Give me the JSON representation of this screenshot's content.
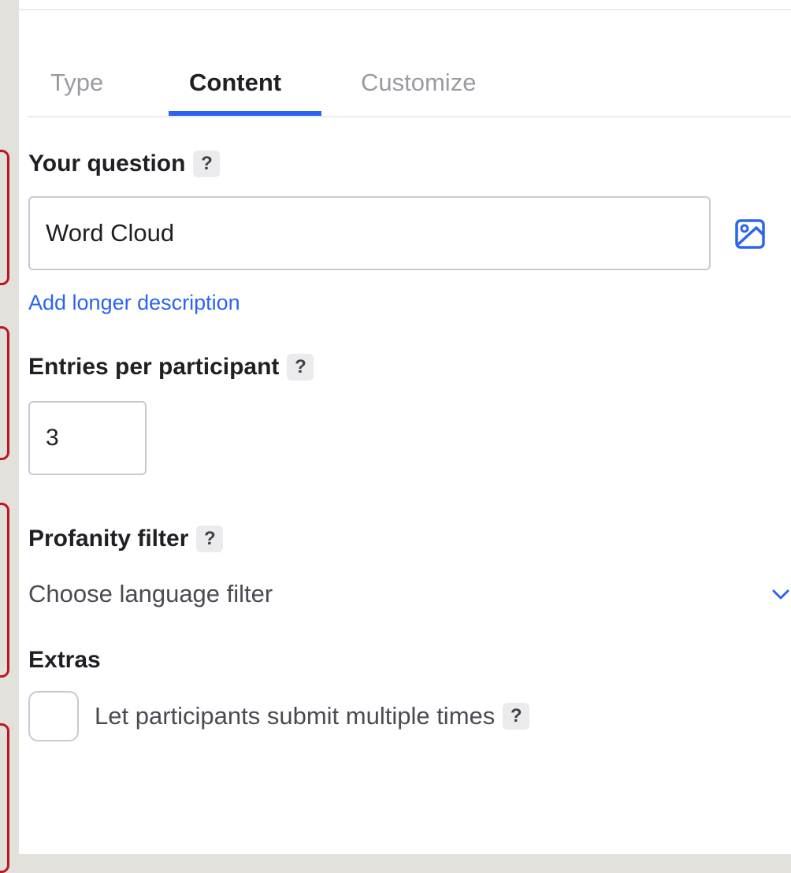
{
  "tabs": [
    {
      "label": "Type",
      "active": false
    },
    {
      "label": "Content",
      "active": true
    },
    {
      "label": "Customize",
      "active": false
    }
  ],
  "question": {
    "label": "Your question",
    "help": "?",
    "value": "Word Cloud",
    "image_icon": "image-icon",
    "add_description": "Add longer description"
  },
  "entries": {
    "label": "Entries per participant",
    "help": "?",
    "value": "3"
  },
  "profanity": {
    "label": "Profanity filter",
    "help": "?",
    "dropdown_label": "Choose language filter",
    "chevron_icon": "chevron-down-icon"
  },
  "extras": {
    "label": "Extras",
    "checkbox_label": "Let participants submit multiple times",
    "help": "?",
    "checked": false
  },
  "colors": {
    "accent": "#2c64f0",
    "outline_red": "#c2151b"
  }
}
